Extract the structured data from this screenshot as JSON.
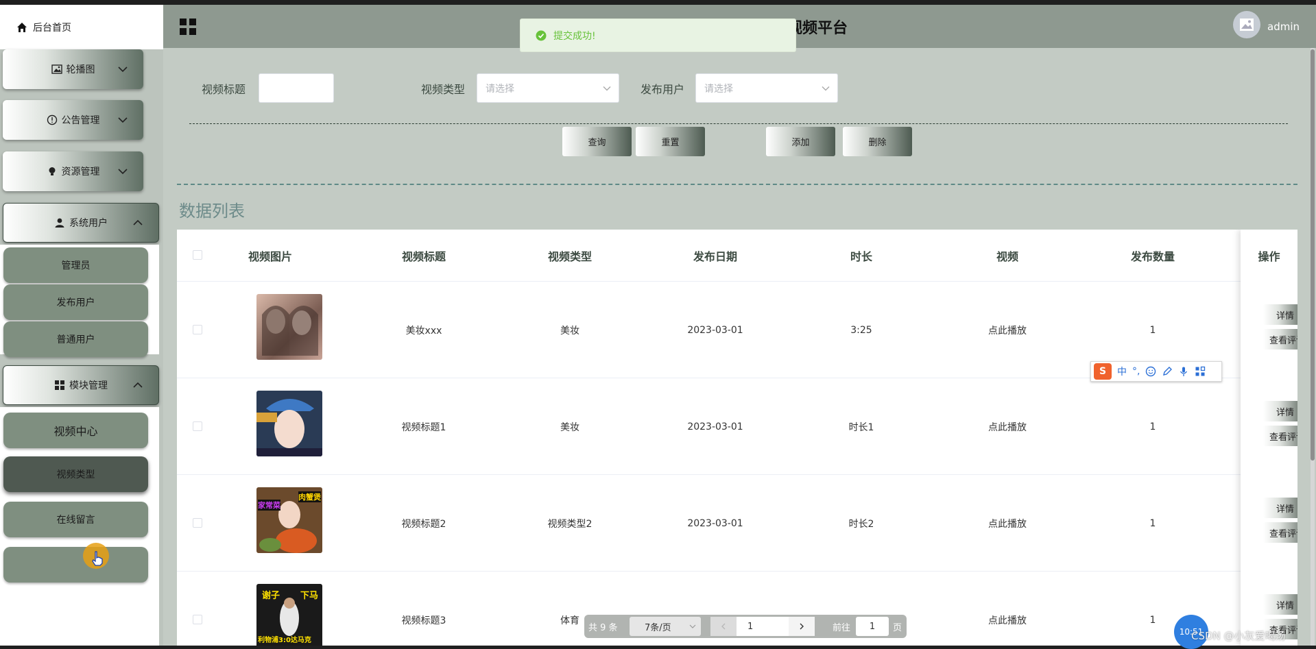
{
  "app": {
    "title": "视频平台",
    "username": "admin",
    "toast": "提交成功!"
  },
  "sidebar": {
    "home": "后台首页",
    "menus": [
      {
        "label": "轮播图",
        "icon": "image-icon"
      },
      {
        "label": "公告管理",
        "icon": "info-circle-icon"
      },
      {
        "label": "资源管理",
        "icon": "bulb-icon"
      },
      {
        "label": "系统用户",
        "icon": "user-icon"
      },
      {
        "label": "模块管理",
        "icon": "grid-icon"
      }
    ],
    "system_users_items": [
      "管理员",
      "发布用户",
      "普通用户"
    ],
    "module_items": [
      "视频中心",
      "视频类型",
      "在线留言"
    ]
  },
  "filters": {
    "title_label": "视频标题",
    "type_label": "视频类型",
    "type_placeholder": "请选择",
    "user_label": "发布用户",
    "user_placeholder": "请选择"
  },
  "actions": {
    "search": "查询",
    "reset": "重置",
    "add": "添加",
    "delete": "删除"
  },
  "list_title": "数据列表",
  "table": {
    "headers": [
      "视频图片",
      "视频标题",
      "视频类型",
      "发布日期",
      "时长",
      "视频",
      "发布数量",
      "操作"
    ],
    "rows": [
      {
        "title": "美妆xxx",
        "type": "美妆",
        "date": "2023-03-01",
        "duration": "3:25",
        "video": "点此播放",
        "count": "1"
      },
      {
        "title": "视频标题1",
        "type": "美妆",
        "date": "2023-03-01",
        "duration": "时长1",
        "video": "点此播放",
        "count": "1"
      },
      {
        "title": "视频标题2",
        "type": "视频类型2",
        "date": "2023-03-01",
        "duration": "时长2",
        "video": "点此播放",
        "count": "1"
      },
      {
        "title": "视频标题3",
        "type": "体育",
        "date": "2023-03-01",
        "duration": "时长3",
        "video": "点此播放",
        "count": "1"
      }
    ],
    "op_detail": "详情",
    "op_comments": "查看评论"
  },
  "thumbnail_texts": {
    "row3_left": "家常菜",
    "row3_right": "肉蟹煲",
    "row4_top_left": "谢子",
    "row4_top_right": "下马",
    "row4_bottom": "利物浦3:0达马克"
  },
  "ime": {
    "lang": "中"
  },
  "pagination": {
    "total": "共 9 条",
    "page_size": "7条/页",
    "current": "1",
    "goto_label": "前往",
    "goto_value": "1",
    "page_suffix": "页"
  },
  "overlay": {
    "clock": "10:51",
    "watermark": "CSDN @小灰爱喝汤"
  },
  "colors": {
    "header": "#8e9990",
    "main_bg": "#c3cbc4",
    "sidebar_item": "#7f8f80",
    "success": "#67c23a"
  }
}
